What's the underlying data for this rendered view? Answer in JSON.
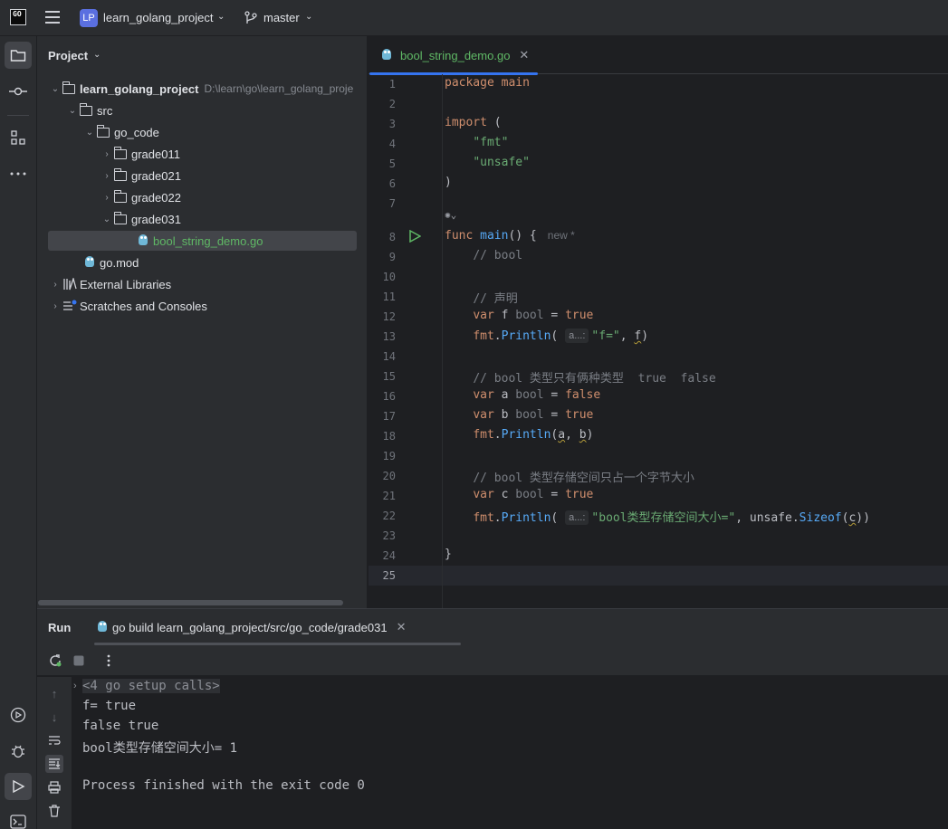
{
  "titlebar": {
    "logo": "GO",
    "project_badge": "LP",
    "project_name": "learn_golang_project",
    "branch": "master"
  },
  "project_panel": {
    "title": "Project",
    "tree": [
      {
        "label": "learn_golang_project",
        "path": "D:\\learn\\go\\learn_golang_proje",
        "type": "folder",
        "expanded": true
      },
      {
        "label": "src",
        "type": "folder",
        "expanded": true
      },
      {
        "label": "go_code",
        "type": "folder",
        "expanded": true
      },
      {
        "label": "grade011",
        "type": "folder",
        "expanded": false
      },
      {
        "label": "grade021",
        "type": "folder",
        "expanded": false
      },
      {
        "label": "grade022",
        "type": "folder",
        "expanded": false
      },
      {
        "label": "grade031",
        "type": "folder",
        "expanded": true
      },
      {
        "label": "bool_string_demo.go",
        "type": "go-file",
        "selected": true
      },
      {
        "label": "go.mod",
        "type": "go-mod"
      },
      {
        "label": "External Libraries",
        "type": "library"
      },
      {
        "label": "Scratches and Consoles",
        "type": "scratches"
      }
    ]
  },
  "editor": {
    "tab_label": "bool_string_demo.go",
    "new_hint": "new *",
    "param_hint": "a...:",
    "line_numbers": [
      "1",
      "2",
      "3",
      "4",
      "5",
      "6",
      "7",
      "8",
      "9",
      "10",
      "11",
      "12",
      "13",
      "14",
      "15",
      "16",
      "17",
      "18",
      "19",
      "20",
      "21",
      "22",
      "23",
      "24",
      "25"
    ],
    "code": {
      "l1_kw": "package",
      "l1_name": "main",
      "l3_kw": "import",
      "l3_paren": "(",
      "l4": "\"fmt\"",
      "l5": "\"unsafe\"",
      "l6": ")",
      "l8_kw": "func",
      "l8_fn": "main",
      "l8_rest": "() {",
      "l9": "// bool",
      "l11": "// 声明",
      "l12_kw": "var",
      "l12_name": "f",
      "l12_type": "bool",
      "l12_eq": "=",
      "l12_val": "true",
      "l13_pkg": "fmt",
      "l13_call": "Println",
      "l13_str": "\"f=\"",
      "l13_arg": "f",
      "l15": "// bool 类型只有俩种类型  true  false",
      "l16_kw": "var",
      "l16_name": "a",
      "l16_type": "bool",
      "l16_eq": "=",
      "l16_val": "false",
      "l17_kw": "var",
      "l17_name": "b",
      "l17_type": "bool",
      "l17_eq": "=",
      "l17_val": "true",
      "l18_pkg": "fmt",
      "l18_call": "Println",
      "l18_a": "a",
      "l18_b": "b",
      "l20": "// bool 类型存储空间只占一个字节大小",
      "l21_kw": "var",
      "l21_name": "c",
      "l21_type": "bool",
      "l21_eq": "=",
      "l21_val": "true",
      "l22_pkg": "fmt",
      "l22_call": "Println",
      "l22_str": "\"bool类型存储空间大小=\"",
      "l22_pkg2": "unsafe",
      "l22_call2": "Sizeof",
      "l22_arg": "c",
      "l24": "}"
    }
  },
  "run_panel": {
    "title": "Run",
    "tab_label": "go build learn_golang_project/src/go_code/grade031",
    "console": [
      "<4 go setup calls>",
      "f= true",
      "false true",
      "bool类型存储空间大小= 1",
      "",
      "Process finished with the exit code 0"
    ]
  },
  "colors": {
    "accent": "#3574f0",
    "keyword": "#cf8e6d",
    "string": "#6aab73",
    "function": "#56a8f5",
    "comment": "#7a7e85",
    "file_green": "#5fb865"
  }
}
